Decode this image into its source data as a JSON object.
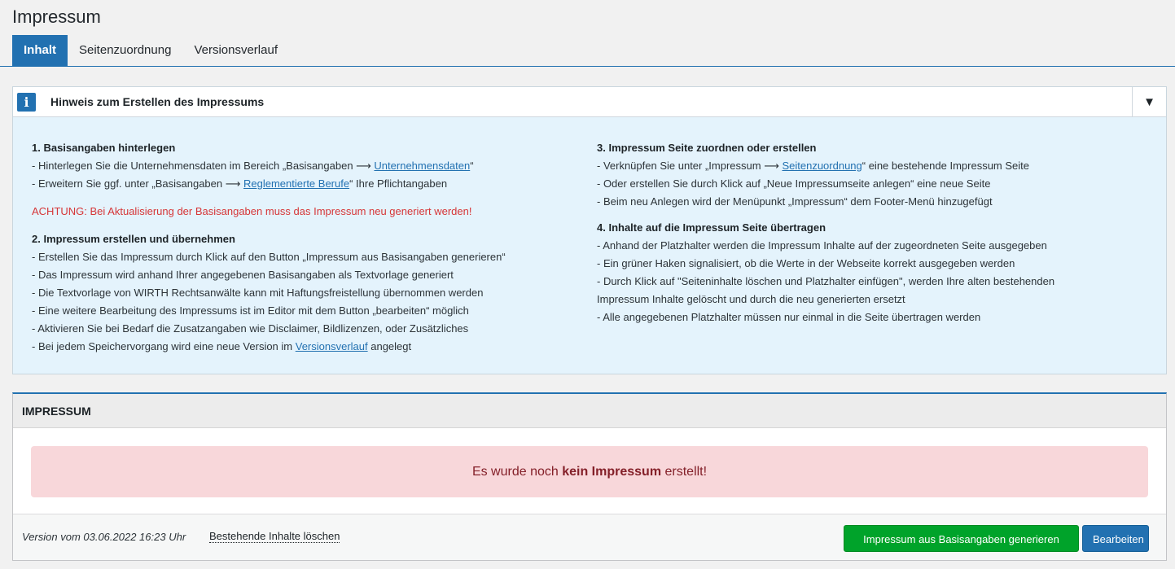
{
  "page": {
    "title": "Impressum"
  },
  "tabs": [
    {
      "label": "Inhalt",
      "active": true
    },
    {
      "label": "Seitenzuordnung",
      "active": false
    },
    {
      "label": "Versionsverlauf",
      "active": false
    }
  ],
  "notice": {
    "icon": "info-icon",
    "icon_text": "i",
    "title": "Hinweis zum Erstellen des Impressums",
    "toggle": "▼",
    "col1": {
      "s1_title": "1. Basisangaben hinterlegen",
      "s1_l1_pre": "- Hinterlegen Sie die Unternehmensdaten im Bereich „Basisangaben ⟶ ",
      "s1_l1_link": "Unternehmensdaten",
      "s1_l1_post": "“",
      "s1_l2_pre": "- Erweitern Sie ggf. unter „Basisangaben ⟶ ",
      "s1_l2_link": "Reglementierte Berufe",
      "s1_l2_post": "“ Ihre Pflichtangaben",
      "warning": "ACHTUNG: Bei Aktualisierung der Basisangaben muss das Impressum neu generiert werden!",
      "s2_title": "2. Impressum erstellen und übernehmen",
      "s2_lines": [
        "- Erstellen Sie das Impressum durch Klick auf den Button „Impressum aus Basisangaben generieren“",
        "- Das Impressum wird anhand Ihrer angegebenen Basisangaben als Textvorlage generiert",
        "- Die Textvorlage von WIRTH Rechtsanwälte kann mit Haftungsfreistellung übernommen werden",
        "- Eine weitere Bearbeitung des Impressums ist im Editor mit dem Button „bearbeiten“ möglich",
        "- Aktivieren Sie bei Bedarf die Zusatzangaben wie Disclaimer, Bildlizenzen, oder Zusätzliches"
      ],
      "s2_last_pre": "- Bei jedem Speichervorgang wird eine neue Version im ",
      "s2_last_link": "Versionsverlauf",
      "s2_last_post": " angelegt"
    },
    "col2": {
      "s3_title": "3. Impressum Seite zuordnen oder erstellen",
      "s3_l1_pre": "- Verknüpfen Sie unter „Impressum ⟶ ",
      "s3_l1_link": "Seitenzuordnung",
      "s3_l1_post": "“ eine bestehende Impressum Seite",
      "s3_l2": "- Oder erstellen Sie durch Klick auf „Neue Impressumseite anlegen“ eine neue Seite",
      "s3_l3": "- Beim neu Anlegen wird der Menüpunkt „Impressum“ dem Footer-Menü hinzugefügt",
      "s4_title": "4. Inhalte auf die Impressum Seite übertragen",
      "s4_lines": [
        "- Anhand der Platzhalter werden die Impressum Inhalte auf der zugeordneten Seite ausgegeben",
        "- Ein grüner Haken signalisiert, ob die Werte in der Webseite korrekt ausgegeben werden",
        "- Durch Klick auf \"Seiteninhalte löschen und Platzhalter einfügen\", werden Ihre alten bestehenden",
        "Impressum Inhalte gelöscht und durch die neu generierten ersetzt",
        "- Alle angegebenen Platzhalter müssen nur einmal in die Seite übertragen werden"
      ]
    }
  },
  "panel": {
    "title": "IMPRESSUM",
    "alert_pre": "Es wurde noch ",
    "alert_bold": "kein Impressum",
    "alert_post": " erstellt!",
    "version": "Version vom 03.06.2022 16:23 Uhr",
    "delete_link": "Bestehende Inhalte löschen",
    "generate_button": "Impressum aus Basisangaben generieren",
    "edit_button": "Bearbeiten"
  },
  "colors": {
    "accent": "#2271b1",
    "success": "#00a32a",
    "danger_bg": "#f8d7da",
    "danger_text": "#842029",
    "warning_text": "#d63638",
    "notice_bg": "#e4f3fc"
  }
}
